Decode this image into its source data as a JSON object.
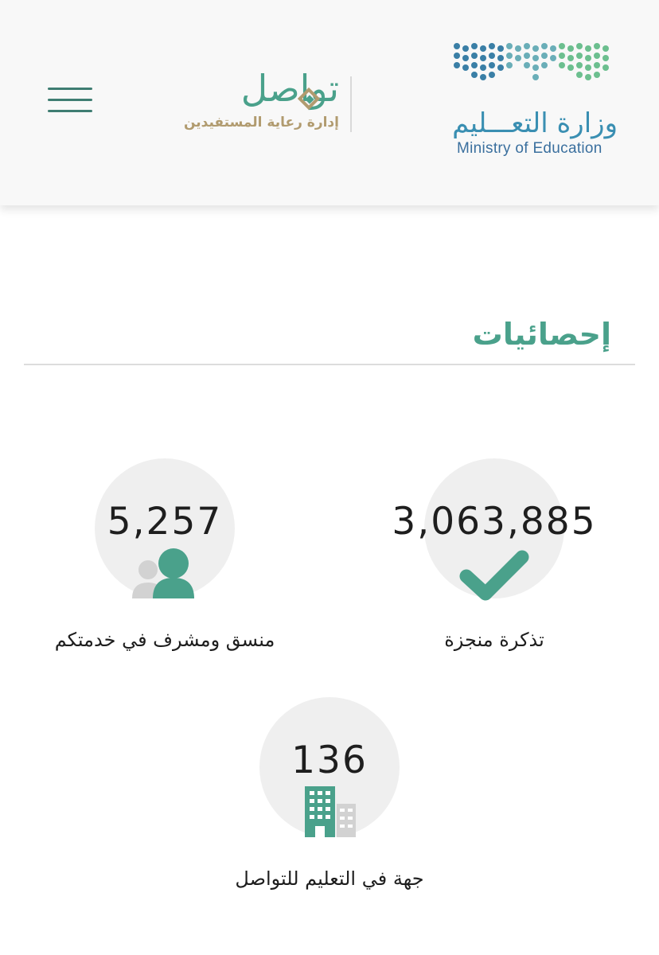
{
  "header": {
    "menu_icon": "hamburger-menu-icon",
    "tawasul_logo": {
      "name": "تواصل",
      "subtitle": "إدارة رعاية المستفيدين"
    },
    "ministry_logo": {
      "name_ar": "وزارة التعـــليم",
      "name_en": "Ministry of Education"
    }
  },
  "main": {
    "section_title": "إحصائيات",
    "stats": [
      {
        "value": "3,063,885",
        "label": "تذكرة منجزة",
        "icon": "checkmark-icon"
      },
      {
        "value": "5,257",
        "label": "منسق ومشرف في خدمتكم",
        "icon": "users-icon"
      },
      {
        "value": "136",
        "label": "جهة في التعليم للتواصل",
        "icon": "building-icon"
      }
    ]
  },
  "colors": {
    "accent": "#4aa18b",
    "gold": "#b19b6f",
    "ministry_blue": "#3a8fb2",
    "circle_bg": "#efefef"
  }
}
